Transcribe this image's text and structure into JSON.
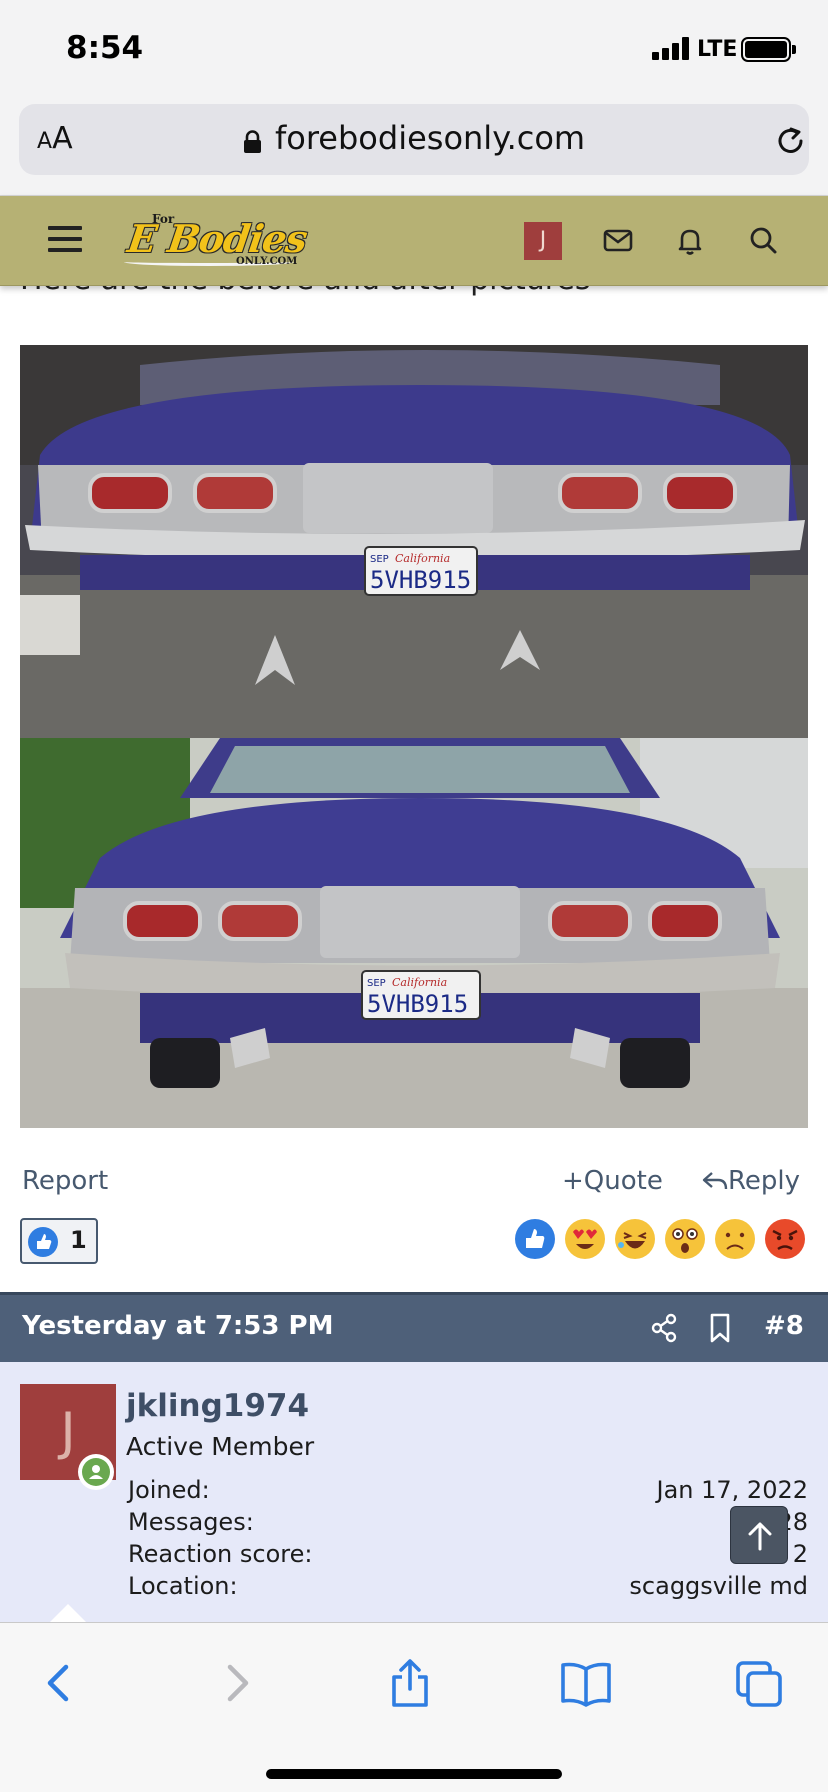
{
  "status_bar": {
    "time": "8:54",
    "network": "LTE"
  },
  "browser": {
    "aa_label_small": "A",
    "aa_label_large": "A",
    "url": "forebodiesonly.com"
  },
  "forum_nav": {
    "logo_top": "For",
    "logo_main": "E Bodies",
    "logo_bottom": "ONLY.COM",
    "avatar_initial": "J"
  },
  "post": {
    "partial_text": "Here are the before and after pictures",
    "photos": [
      {
        "plate": "5VHB915",
        "plate_state": "California",
        "plate_month": "SEP"
      },
      {
        "plate": "5VHB915",
        "plate_state": "California",
        "plate_month": "SEP"
      }
    ],
    "actions": {
      "report": "Report",
      "quote": "Quote",
      "reply": "Reply"
    },
    "reaction_count": "1",
    "reactions": [
      "like",
      "love",
      "haha",
      "wow",
      "sad",
      "angry"
    ]
  },
  "next_post": {
    "date": "Yesterday at 7:53 PM",
    "number": "#8",
    "user": {
      "avatar_initial": "J",
      "username": "jkling1974",
      "title": "Active Member",
      "stats": [
        {
          "label": "Joined:",
          "value": "Jan 17, 2022"
        },
        {
          "label": "Messages:",
          "value": "28"
        },
        {
          "label": "Reaction score:",
          "value": "2"
        },
        {
          "label": "Location:",
          "value": "scaggsville md"
        }
      ]
    }
  },
  "colors": {
    "nav_background": "#b6b174",
    "post_header": "#4e6079",
    "user_block": "#e6e9f9",
    "link": "#47596f",
    "avatar": "#9f3e3d",
    "ios_blue": "#2f7de1"
  }
}
